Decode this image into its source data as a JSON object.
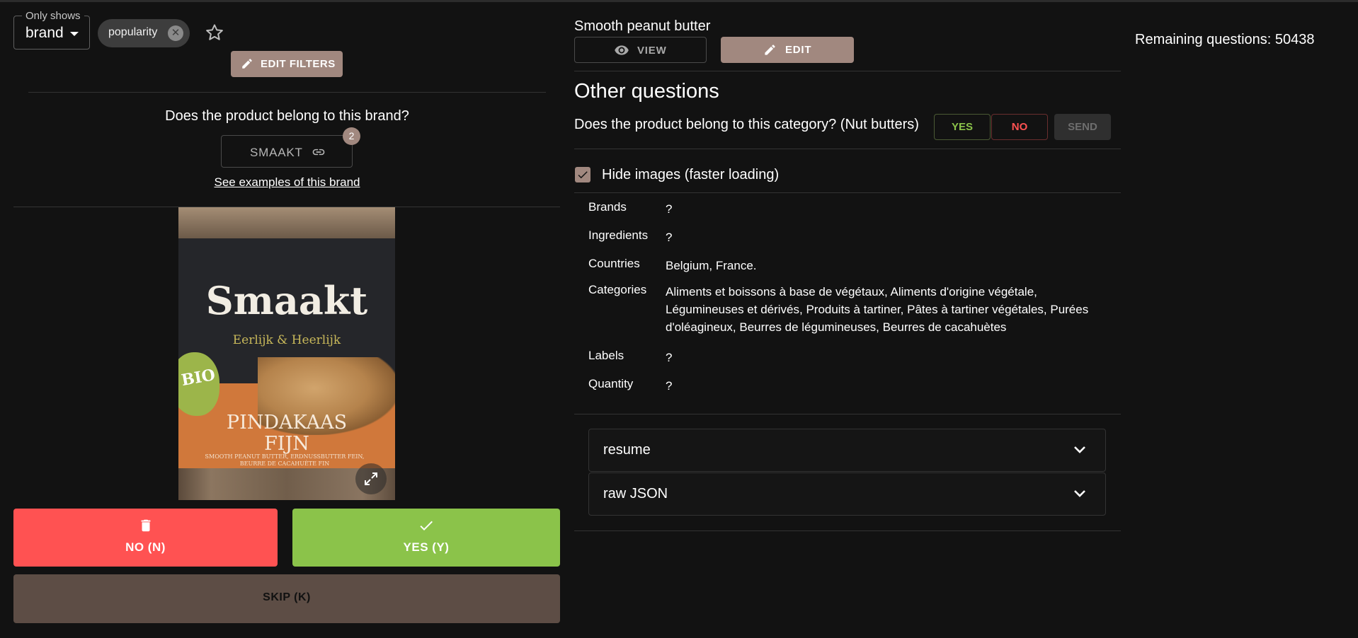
{
  "filters": {
    "legend": "Only shows",
    "selected": "brand",
    "chip_label": "popularity",
    "edit_filters_label": "EDIT FILTERS"
  },
  "question": {
    "text": "Does the product belong to this brand?",
    "brand_value": "SMAAKT",
    "badge_count": "2",
    "examples_link": "See examples of this brand"
  },
  "product_image": {
    "brand": "Smaakt",
    "slogan": "Eerlijk & Heerlijk",
    "bio": "BIO",
    "name_line1": "PINDAKAAS",
    "name_line2": "FIJN",
    "smallprint": "SMOOTH PEANUT BUTTER, ERDNUSSBUTTER FEIN, BEURRE DE CACAHUÈTE FIN"
  },
  "actions": {
    "no_label": "NO (N)",
    "yes_label": "YES (Y)",
    "skip_label": "SKIP (K)"
  },
  "product": {
    "title": "Smooth peanut butter",
    "view_label": "VIEW",
    "edit_label": "EDIT"
  },
  "other_questions": {
    "title": "Other questions",
    "category_question": "Does the product belong to this category? (Nut butters)",
    "yes_label": "YES",
    "no_label": "NO",
    "send_label": "SEND"
  },
  "hide_images": {
    "label": "Hide images (faster loading)",
    "checked": true
  },
  "info": [
    {
      "key": "Brands",
      "value": "?"
    },
    {
      "key": "Ingredients",
      "value": "?"
    },
    {
      "key": "Countries",
      "value": "Belgium, France."
    },
    {
      "key": "Categories",
      "value": "Aliments et boissons à base de végétaux, Aliments d'origine végétale, Légumineuses et dérivés, Produits à tartiner, Pâtes à tartiner végétales, Purées d'oléagineux, Beurres de légumineuses, Beurres de cacahuètes"
    },
    {
      "key": "Labels",
      "value": "?"
    },
    {
      "key": "Quantity",
      "value": "?"
    }
  ],
  "accordions": [
    {
      "label": "resume"
    },
    {
      "label": "raw JSON"
    }
  ],
  "remaining": "Remaining questions: 50438",
  "colors": {
    "background": "#121212",
    "accent": "#a1887f",
    "no": "#ff5252",
    "yes": "#8bc34a",
    "skip": "#5d4d45"
  },
  "icons": [
    "chevron-down-icon",
    "close-icon",
    "star-icon",
    "pencil-icon",
    "link-icon",
    "expand-icon",
    "trash-icon",
    "check-icon",
    "eye-icon"
  ]
}
